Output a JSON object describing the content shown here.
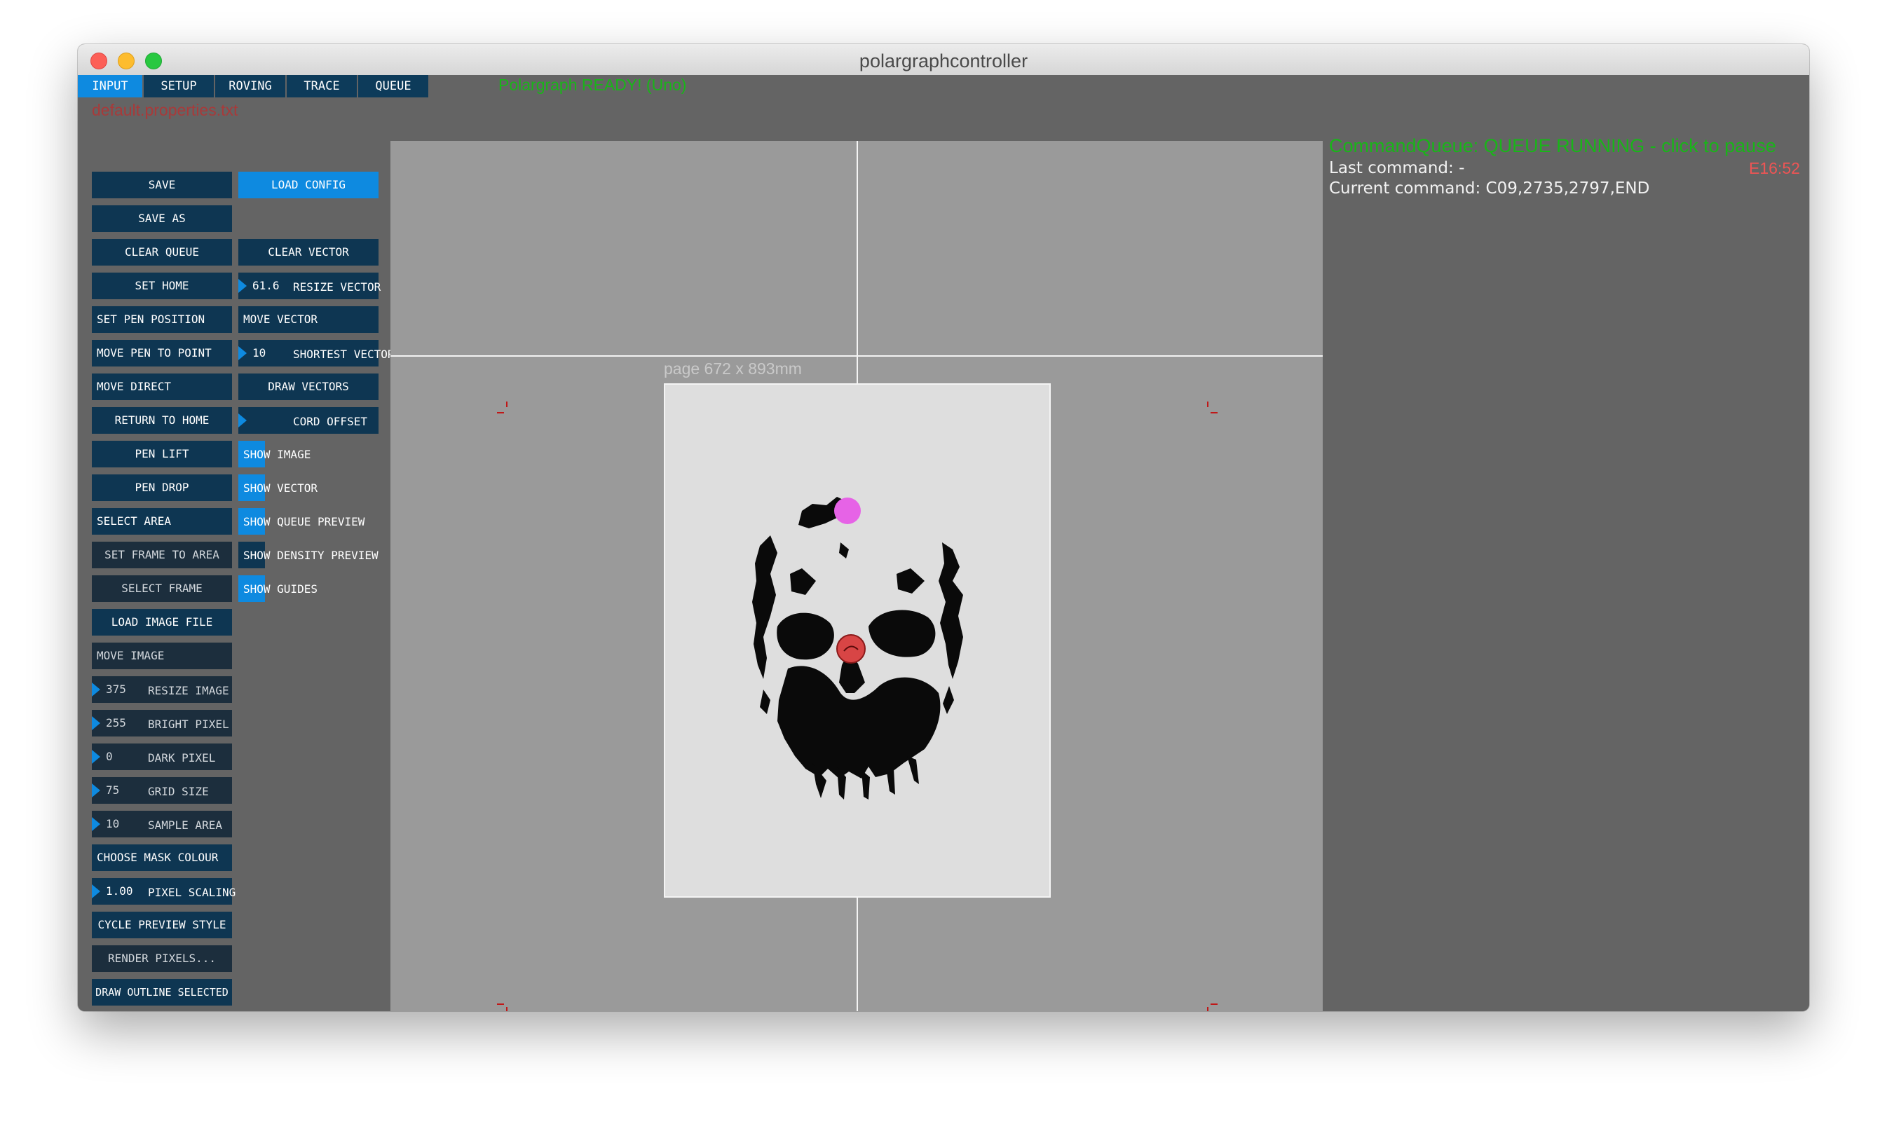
{
  "window": {
    "title": "polargraphcontroller"
  },
  "tabs": [
    {
      "label": "INPUT",
      "active": true
    },
    {
      "label": "SETUP",
      "active": false
    },
    {
      "label": "ROVING",
      "active": false
    },
    {
      "label": "TRACE",
      "active": false
    },
    {
      "label": "QUEUE",
      "active": false
    }
  ],
  "status": {
    "ready": "Polargraph READY! (Uno)",
    "properties_file": "default.properties.txt"
  },
  "left_column": {
    "save": "SAVE",
    "save_as": "SAVE AS",
    "clear_queue": "CLEAR QUEUE",
    "set_home": "SET HOME",
    "set_pen_position": "SET PEN POSITION",
    "move_pen_to_point": "MOVE PEN TO POINT",
    "move_direct": "MOVE DIRECT",
    "return_to_home": "RETURN TO HOME",
    "pen_lift": "PEN LIFT",
    "pen_drop": "PEN DROP",
    "select_area": "SELECT AREA",
    "set_frame_to_area": "SET FRAME TO AREA",
    "select_frame": "SELECT FRAME",
    "load_image_file": "LOAD IMAGE FILE",
    "move_image": "MOVE IMAGE",
    "resize_image": {
      "value": "375",
      "label": "RESIZE IMAGE"
    },
    "bright_pixel": {
      "value": "255",
      "label": "BRIGHT PIXEL"
    },
    "dark_pixel": {
      "value": "0",
      "label": "DARK PIXEL"
    },
    "grid_size": {
      "value": "75",
      "label": "GRID SIZE"
    },
    "sample_area": {
      "value": "10",
      "label": "SAMPLE AREA"
    },
    "choose_mask_colour": "CHOOSE MASK COLOUR",
    "pixel_scaling": {
      "value": "1.00",
      "label": "PIXEL SCALING"
    },
    "cycle_preview_style": "CYCLE PREVIEW STYLE",
    "render_pixels": "RENDER PIXELS...",
    "draw_outline_selected": "DRAW OUTLINE SELECTED"
  },
  "right_column": {
    "load_config": "LOAD CONFIG",
    "clear_vector": "CLEAR VECTOR",
    "resize_vector": {
      "value": "61.6",
      "label": "RESIZE VECTOR"
    },
    "move_vector": "MOVE VECTOR",
    "shortest_vector": {
      "value": "10",
      "label": "SHORTEST VECTOR"
    },
    "draw_vectors": "DRAW VECTORS",
    "cord_offset": {
      "value": "",
      "label": "CORD OFFSET"
    },
    "show_image": {
      "label": "SHOW IMAGE",
      "on": true
    },
    "show_vector": {
      "label": "SHOW VECTOR",
      "on": true
    },
    "show_queue_preview": {
      "label": "SHOW QUEUE PREVIEW",
      "on": true
    },
    "show_density_preview": {
      "label": "SHOW DENSITY PREVIEW",
      "on": false
    },
    "show_guides": {
      "label": "SHOW GUIDES",
      "on": true
    }
  },
  "canvas": {
    "page_label": "page 672 x 893mm"
  },
  "queue_panel": {
    "command_queue": "CommandQueue: QUEUE RUNNING - click to pause",
    "last_command": "Last command: -",
    "current_command": "Current command: C09,2735,2797,END",
    "time": "E16:52"
  },
  "colors": {
    "button": "#0e3652",
    "accent": "#0e8ae0",
    "ready_green": "#19b519",
    "panel_bg": "#646464",
    "canvas_bg": "#9a9a9a"
  }
}
